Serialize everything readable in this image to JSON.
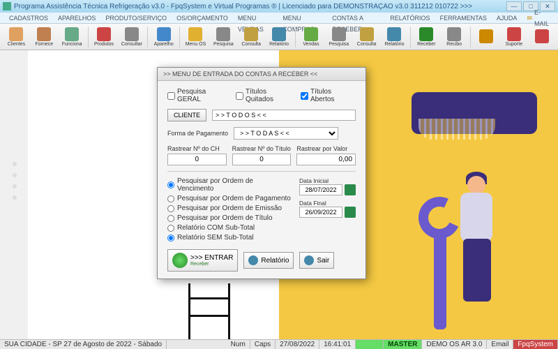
{
  "window": {
    "title": "Programa Assistência Técnica Refrigeração v3.0 - FpqSystem e Virtual Programas ® | Licenciado para  DEMONSTRAÇÃO v3.0 311212 010722 >>>"
  },
  "menu": [
    "CADASTROS",
    "APARELHOS",
    "PRODUTO/SERVIÇO",
    "OS/ORÇAMENTO",
    "MENU VENDAS",
    "MENU COMPRAS",
    "CONTAS A RECEBER",
    "RELATÓRIOS",
    "FERRAMENTAS",
    "AJUDA"
  ],
  "menu_email": "E-MAIL",
  "toolbar": [
    {
      "label": "Clientes",
      "color": "#e0a060"
    },
    {
      "label": "Fornece",
      "color": "#c08050"
    },
    {
      "label": "Funciona",
      "color": "#6a8"
    },
    {
      "label": "Produtos",
      "color": "#c44"
    },
    {
      "label": "Consultar",
      "color": "#888"
    },
    {
      "label": "Aparelho",
      "color": "#48c"
    },
    {
      "label": "Menu OS",
      "color": "#e0b030"
    },
    {
      "label": "Pesquisa",
      "color": "#888"
    },
    {
      "label": "Consulta",
      "color": "#c0a040"
    },
    {
      "label": "Relatório",
      "color": "#48a"
    },
    {
      "label": "Vendas",
      "color": "#6a4"
    },
    {
      "label": "Pesquisa",
      "color": "#888"
    },
    {
      "label": "Consulta",
      "color": "#c0a040"
    },
    {
      "label": "Relatório",
      "color": "#48a"
    },
    {
      "label": "Receber",
      "color": "#2a8a2a"
    },
    {
      "label": "Recibo",
      "color": "#888"
    },
    {
      "label": "",
      "color": "#c80"
    },
    {
      "label": "Suporte",
      "color": "#c44"
    },
    {
      "label": "",
      "color": "#c44"
    }
  ],
  "dialog": {
    "title": ">>  MENU DE ENTRADA DO CONTAS A RECEBER  <<",
    "chk_geral": "Pesquisa GERAL",
    "chk_quitados": "Títulos Quitados",
    "chk_abertos": "Títulos Abertos",
    "btn_cliente": "CLIENTE",
    "cliente_val": "> > T O D O S < <",
    "forma_label": "Forma de Pagamento",
    "forma_val": "> > T O D A S < <",
    "track_ch": "Rastrear Nº do CH",
    "track_ch_val": "0",
    "track_titulo": "Rastrear Nº do Título",
    "track_titulo_val": "0",
    "track_valor": "Rastrear por Valor",
    "track_valor_val": "0,00",
    "rad_venc": "Pesquisar por Ordem de Vencimento",
    "rad_pag": "Pesquisar por Ordem de Pagamento",
    "rad_emis": "Pesquisar por Ordem de Emissão",
    "rad_tit": "Pesquisar por Ordem de Título",
    "rad_com": "Relatório COM Sub-Total",
    "rad_sem": "Relatório SEM Sub-Total",
    "date_ini_lbl": "Data Inicial",
    "date_ini": "28/07/2022",
    "date_fin_lbl": "Data Final",
    "date_fin": "26/09/2022",
    "btn_entrar": ">>> ENTRAR",
    "btn_entrar_sub": "Receber",
    "btn_relatorio": "Relatório",
    "btn_sair": "Sair"
  },
  "status": {
    "loc": "SUA CIDADE - SP 27 de Agosto de 2022 - Sábado",
    "num": "Num",
    "caps": "Caps",
    "date": "27/08/2022",
    "time": "16:41:01",
    "master": "MASTER",
    "demo": "DEMO OS AR 3.0",
    "email": "Email",
    "fpq": "FpqSystem"
  }
}
